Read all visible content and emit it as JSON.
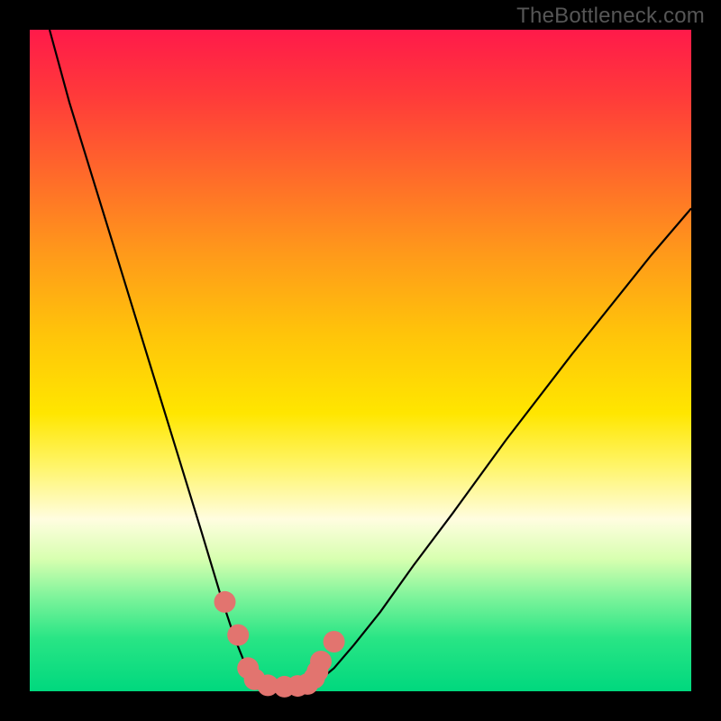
{
  "watermark": "TheBottleneck.com",
  "chart_data": {
    "type": "line",
    "title": "",
    "xlabel": "",
    "ylabel": "",
    "xlim": [
      0,
      100
    ],
    "ylim": [
      0,
      100
    ],
    "series": [
      {
        "name": "bottleneck-curve",
        "x": [
          3,
          6,
          10,
          14,
          18,
          22,
          26,
          29,
          31,
          33,
          35,
          37,
          40,
          43,
          46,
          49,
          53,
          58,
          64,
          72,
          82,
          94,
          100
        ],
        "y": [
          100,
          89,
          76,
          63,
          50,
          37,
          24,
          14,
          8,
          3,
          1,
          0.5,
          0.5,
          1,
          3.5,
          7,
          12,
          19,
          27,
          38,
          51,
          66,
          73
        ]
      },
      {
        "name": "highlight-dots",
        "x": [
          29.5,
          31.5,
          33,
          34,
          36,
          38.5,
          40.5,
          42,
          43,
          43.5,
          44,
          46
        ],
        "y": [
          13.5,
          8.5,
          3.5,
          1.8,
          0.9,
          0.7,
          0.8,
          1.1,
          2.0,
          3.0,
          4.5,
          7.5
        ]
      }
    ],
    "colors": {
      "curve": "#000000",
      "dots": "#e2746f"
    }
  }
}
